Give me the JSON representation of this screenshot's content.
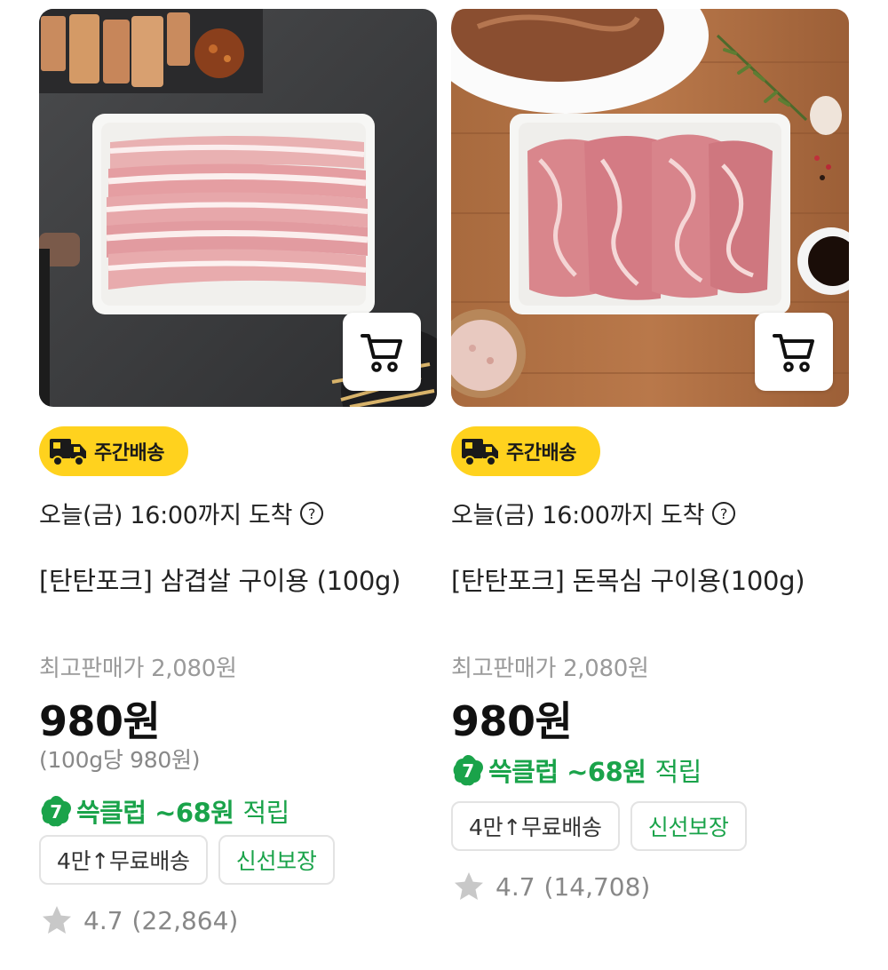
{
  "products": [
    {
      "delivery_badge": "주간배송",
      "arrival": "오늘(금) 16:00까지 도착",
      "name": "[탄탄포크] 삼겹살 구이용 (100g)",
      "orig_price_label": "최고판매가 2,080원",
      "price": "980원",
      "unit_price": "(100g당 980원)",
      "club_badge": "7",
      "club_text": "쓱클럽 ~68원",
      "club_suffix": "적립",
      "tags": [
        "4만↑무료배송",
        "신선보장"
      ],
      "rating": "4.7",
      "review_count": "(22,864)",
      "image_icon": "pork-belly-photo"
    },
    {
      "delivery_badge": "주간배송",
      "arrival": "오늘(금) 16:00까지 도착",
      "name": "[탄탄포크] 돈목심 구이용(100g)",
      "orig_price_label": "최고판매가 2,080원",
      "price": "980원",
      "club_badge": "7",
      "club_text": "쓱클럽 ~68원",
      "club_suffix": "적립",
      "tags": [
        "4만↑무료배송",
        "신선보장"
      ],
      "rating": "4.7",
      "review_count": "(14,708)",
      "image_icon": "pork-neck-photo"
    }
  ],
  "colors": {
    "badge_yellow": "#ffd21e",
    "club_green": "#1aa34a",
    "muted_gray": "#9a9a9a",
    "star_gray": "#c8c8c8"
  }
}
